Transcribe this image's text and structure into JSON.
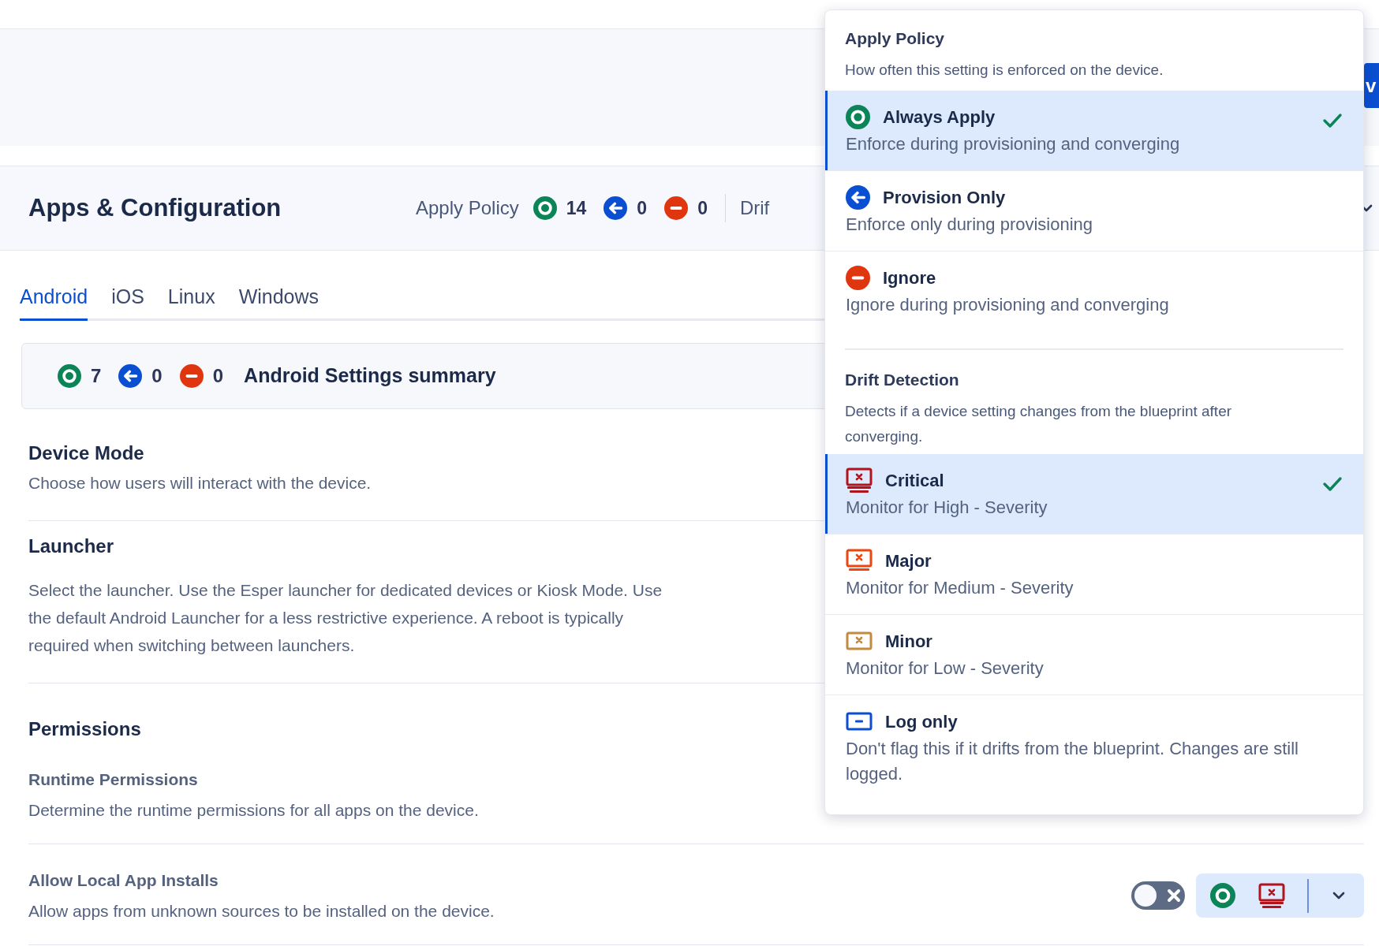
{
  "top_button": {
    "label": "v"
  },
  "header": {
    "title": "Apps & Configuration",
    "apply_label": "Apply Policy",
    "counts": [
      {
        "kind": "always",
        "value": "14"
      },
      {
        "kind": "provision",
        "value": "0"
      },
      {
        "kind": "ignore",
        "value": "0"
      }
    ],
    "drift_label": "Drif"
  },
  "tabs": [
    {
      "label": "Android",
      "selected": true
    },
    {
      "label": "iOS",
      "selected": false
    },
    {
      "label": "Linux",
      "selected": false
    },
    {
      "label": "Windows",
      "selected": false
    }
  ],
  "summary": {
    "counts": [
      {
        "kind": "always",
        "value": "7"
      },
      {
        "kind": "provision",
        "value": "0"
      },
      {
        "kind": "ignore",
        "value": "0"
      }
    ],
    "title": "Android Settings summary"
  },
  "sections": [
    {
      "kind": "section",
      "title": "Device Mode",
      "description": "Choose how users will interact with the device."
    },
    {
      "kind": "section",
      "title": "Launcher",
      "description": "Select the launcher. Use the Esper launcher for dedicated devices or Kiosk Mode. Use the default Android Launcher for a less restrictive experience. A reboot is typically required when switching between launchers."
    },
    {
      "kind": "heading",
      "title": "Permissions"
    },
    {
      "kind": "setting",
      "title": "Runtime Permissions",
      "description": "Determine the runtime permissions for all apps on the device."
    },
    {
      "kind": "setting",
      "title": "Allow Local App Installs",
      "description": "Allow apps from unknown sources to be installed on the device.",
      "toggle": {
        "on": false
      },
      "policy": {
        "apply": {
          "kind": "always"
        },
        "drift": {
          "kind": "critical"
        }
      }
    }
  ],
  "dropdown": {
    "apply_policy": {
      "title": "Apply Policy",
      "description": "How often this setting is enforced on the device.",
      "options": [
        {
          "kind": "always",
          "label": "Always Apply",
          "description": "Enforce during provisioning and converging",
          "selected": true
        },
        {
          "kind": "provision",
          "label": "Provision Only",
          "description": "Enforce only during provisioning",
          "selected": false
        },
        {
          "kind": "ignore",
          "label": "Ignore",
          "description": "Ignore during provisioning and converging",
          "selected": false
        }
      ]
    },
    "drift_detection": {
      "title": "Drift Detection",
      "description": "Detects if a device setting changes from the blueprint after converging.",
      "options": [
        {
          "kind": "critical",
          "label": "Critical",
          "description": "Monitor for High - Severity",
          "selected": true
        },
        {
          "kind": "major",
          "label": "Major",
          "description": "Monitor for Medium - Severity",
          "selected": false
        },
        {
          "kind": "minor",
          "label": "Minor",
          "description": "Monitor for Low - Severity",
          "selected": false
        },
        {
          "kind": "log",
          "label": "Log only",
          "description": "Don't flag this if it drifts from the blueprint. Changes are still logged.",
          "selected": false
        }
      ]
    }
  }
}
